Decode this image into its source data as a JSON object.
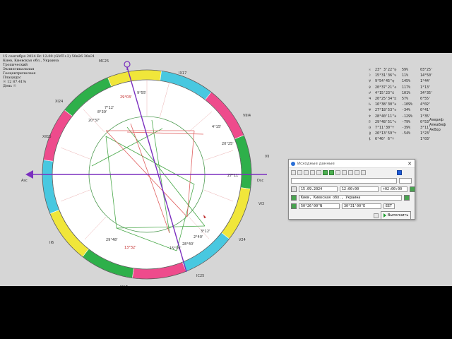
{
  "header_info": {
    "line1": "15 сентября 2024 Вс 12:00 (GMT+2) 50в26 30в31",
    "line2": "Киев, Киевская обл., Украина",
    "line3": "Тропический",
    "line4": "Эклиптикальная",
    "line5": "Геоцентрическая",
    "line6": "Плацидус",
    "line7": "☉ 12 87.41%",
    "line8": "День ☉"
  },
  "chart_labels": {
    "mc": "MC25",
    "ic": "IC25",
    "asc": "Asc",
    "dsc": "Dsc",
    "house_labels": [
      "IX17",
      "VIII4",
      "VII",
      "VI3",
      "V24",
      "XII15",
      "XI24",
      "II6",
      "III17"
    ],
    "planet_labels": [
      "29°03'",
      "7°12'",
      "8°39'",
      "20°37'",
      "9°55'",
      "4°15'",
      "20°25'",
      "27°11'",
      "3°12'",
      "2°40'",
      "28°40'",
      "15°39'",
      "29°48'",
      "13°32'"
    ]
  },
  "planets_table": [
    {
      "glyph": "☉",
      "pos": "23° 3'22\"♍",
      "speed": "59%",
      "decl": "03°25'"
    },
    {
      "glyph": "☽",
      "pos": "15°31'36\"♑",
      "speed": "11%",
      "decl": "14°50'"
    },
    {
      "glyph": "☿",
      "pos": "9°54'45\"♍",
      "speed": "145%",
      "decl": "1°44'"
    },
    {
      "glyph": "♀",
      "pos": "20°37'21\"♎",
      "speed": "117%",
      "decl": "1°13'"
    },
    {
      "glyph": "♂",
      "pos": "4°15'23\"♋",
      "speed": "101%",
      "decl": "34°35'"
    },
    {
      "glyph": "♃",
      "pos": "20°25'34\"♊",
      "speed": "57%",
      "decl": "6°55'"
    },
    {
      "glyph": "♄",
      "pos": "16°38'30\"♓",
      "speed": "-109%",
      "decl": "4°02'"
    },
    {
      "glyph": "♅",
      "pos": "27°18'53\"♉",
      "speed": "-34%",
      "decl": "0°41'"
    },
    {
      "glyph": "♆",
      "pos": "28°40'11\"♓",
      "speed": "-129%",
      "decl": "1°35'"
    },
    {
      "glyph": "♇",
      "pos": "29°48'51\"♑",
      "speed": "-79%",
      "decl": "0°53'"
    },
    {
      "glyph": "☊",
      "pos": "7°11'30\"♈",
      "speed": "-39%",
      "decl": "3°11'"
    },
    {
      "glyph": "⚷",
      "pos": "26°13'59\"♈",
      "speed": "-54%",
      "decl": "1°23'"
    },
    {
      "glyph": "⚸",
      "pos": "6°40' 6\"♈",
      "speed": "",
      "decl": "1°03'"
    }
  ],
  "side_labels": [
    "Азериф",
    "Алкабиф",
    "Акбор"
  ],
  "dialog": {
    "title": "Исходные данные",
    "close": "✕",
    "date": "15.09.2024",
    "time": "12:00:00",
    "tz": "+02:00:00",
    "place": "Киев, Киевская обл., Украина",
    "lat": "50°26'00\"N",
    "lon": "30°31'00\"E",
    "zone": "EET",
    "run_label": "Выполнить"
  }
}
